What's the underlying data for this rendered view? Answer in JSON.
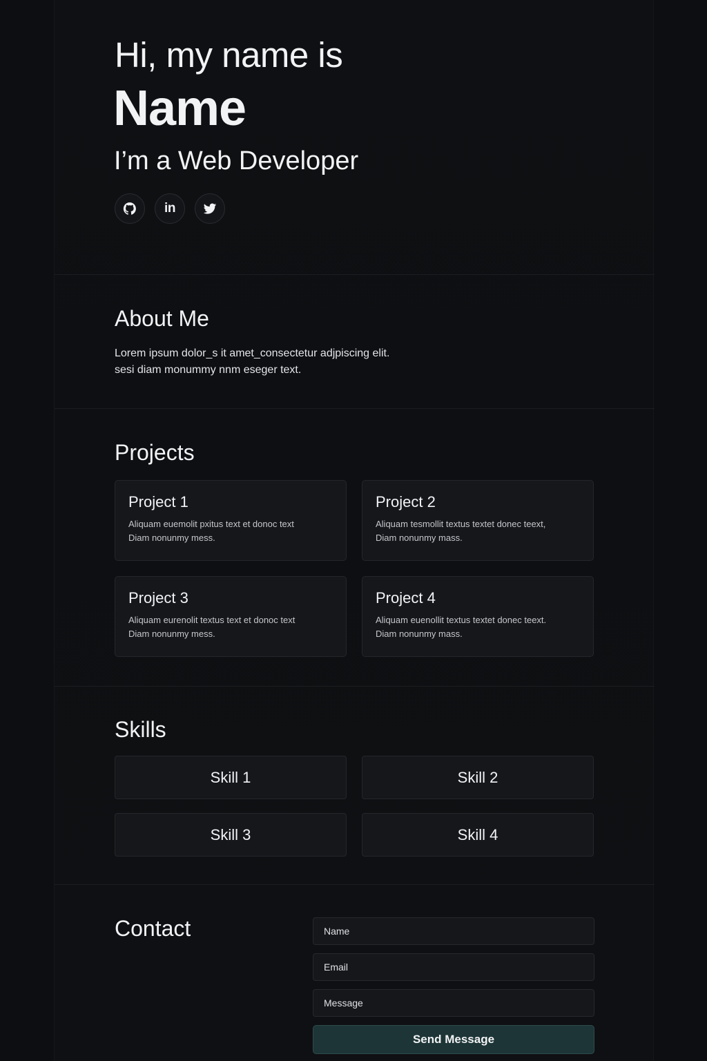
{
  "hero": {
    "greeting": "Hi, my name is",
    "name": "Name",
    "role": "I’m a Web Developer",
    "socials": [
      {
        "icon": "github-icon"
      },
      {
        "icon": "linkedin-icon",
        "glyph": "in"
      },
      {
        "icon": "twitter-icon"
      }
    ]
  },
  "about": {
    "title": "About Me",
    "line1": "Lorem ipsum dolor_s it amet_consectetur adjpiscing elit.",
    "line2": "sesi diam monummy nnm eseger text."
  },
  "projects": {
    "title": "Projects",
    "items": [
      {
        "title": "Project 1",
        "line1": "Aliquam euemolit pxitus text et donoc text",
        "line2": "Diam nonunmy mess."
      },
      {
        "title": "Project 2",
        "line1": "Aliquam tesmollit textus textet donec teext,",
        "line2": "Diam nonunmy mass."
      },
      {
        "title": "Project 3",
        "line1": "Aliquam eurenolit textus text et donoc text",
        "line2": "Diam nonunmy mess."
      },
      {
        "title": "Project 4",
        "line1": "Aliquam euenollit textus textet donec teext.",
        "line2": "Diam nonunmy mass."
      }
    ]
  },
  "skills": {
    "title": "Skills",
    "items": [
      "Skill 1",
      "Skill 2",
      "Skill 3",
      "Skill 4"
    ]
  },
  "contact": {
    "title": "Contact",
    "name_placeholder": "Name",
    "email_placeholder": "Email",
    "message_placeholder": "Message",
    "send_label": "Send Message"
  },
  "colors": {
    "background": "#0d0e11",
    "card": "#16171b",
    "accent_button": "#1d3537",
    "text": "#f2f3f5"
  }
}
